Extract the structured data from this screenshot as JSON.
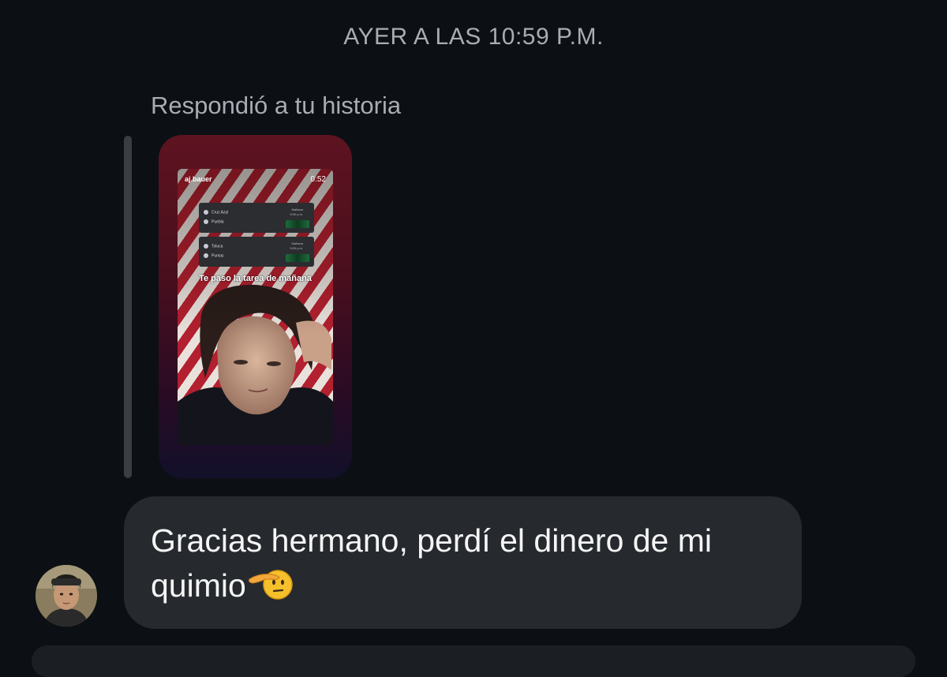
{
  "timestamp": "AYER A LAS 10:59 P.M.",
  "reply": {
    "label": "Respondió a tu historia"
  },
  "story": {
    "username": "aj.bauer",
    "time": "0:52",
    "matches": [
      {
        "team1": "Cruz Azul",
        "team2": "Puebla",
        "when_line1": "Mañana",
        "when_line2": "9:00 p.m."
      },
      {
        "team1": "Toluca",
        "team2": "Pumas",
        "when_line1": "Mañana",
        "when_line2": "9:00 p.m."
      }
    ],
    "caption": "Te paso la tarea de mañana"
  },
  "message": {
    "text": "Gracias hermano, perdí el dinero de mi quimio",
    "emoji": "saluting-face-emoji"
  },
  "colors": {
    "background": "#0c1014",
    "bubble": "#262a2e",
    "muted_text": "#a8acb3"
  }
}
